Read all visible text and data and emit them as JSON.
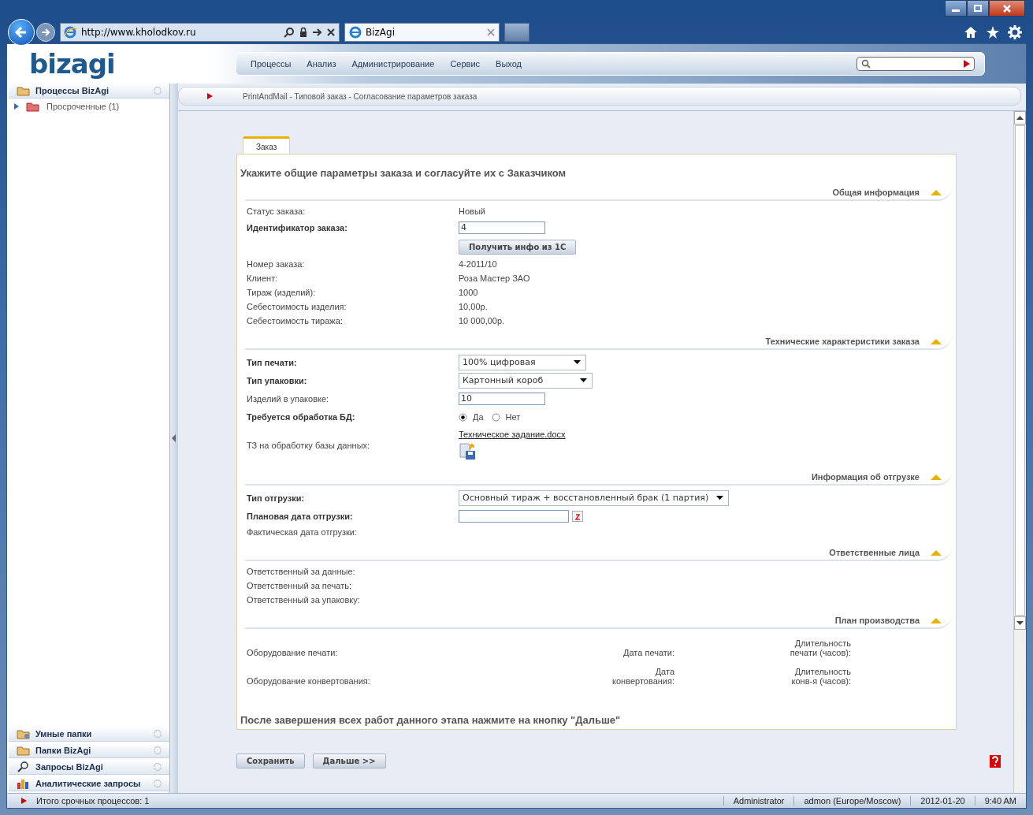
{
  "browser": {
    "url": "http://www.kholodkov.ru",
    "tab_title": "BizAgi"
  },
  "app": {
    "logo": "bizagi",
    "menu": [
      "Процессы",
      "Анализ",
      "Администрирование",
      "Сервис",
      "Выход"
    ],
    "breadcrumb": "PrintAndMail - Типовой заказ - Согласование параметров заказа"
  },
  "sidebar": {
    "top_panel": {
      "title": "Процессы BizAgi",
      "items": [
        {
          "label": "Просроченные (1)",
          "expanded": false
        }
      ]
    },
    "bottom_panels": [
      {
        "title": "Умные папки",
        "kind": "smart"
      },
      {
        "title": "Папки BizAgi",
        "kind": "folders"
      },
      {
        "title": "Запросы BizAgi",
        "kind": "search"
      },
      {
        "title": "Аналитические запросы",
        "kind": "chart"
      }
    ]
  },
  "form": {
    "tabs": [
      {
        "label": "Заказ",
        "selected": true
      }
    ],
    "heading": "Укажите общие параметры заказа и согласуйте их с Заказчиком",
    "sections": [
      {
        "title": "Общая информация",
        "expanded": true,
        "kind": "fields",
        "rows": [
          {
            "label": "Статус заказа:",
            "bold": false,
            "kind": "text",
            "value": "Новый"
          },
          {
            "label": "Идентификатор заказа:",
            "bold": true,
            "kind": "input",
            "value": "4"
          },
          {
            "kind": "button",
            "value": "Получить инфо из 1С"
          },
          {
            "label": "Номер заказа:",
            "bold": false,
            "kind": "text",
            "value": "4-2011/10"
          },
          {
            "label": "Клиент:",
            "bold": false,
            "kind": "text",
            "value": "Роза Мастер ЗАО"
          },
          {
            "label": "Тираж (изделий):",
            "bold": false,
            "kind": "text",
            "value": "1000"
          },
          {
            "label": "Себестоимость изделия:",
            "bold": false,
            "kind": "text",
            "value": "10,00р."
          },
          {
            "label": "Себестоимость тиража:",
            "bold": false,
            "kind": "text",
            "value": "10 000,00р."
          }
        ]
      },
      {
        "title": "Технические характеристики заказа",
        "expanded": true,
        "kind": "fields",
        "rows": [
          {
            "label": "Тип печати:",
            "bold": true,
            "kind": "select",
            "value": "100% цифровая"
          },
          {
            "label": "Тип упаковки:",
            "bold": true,
            "kind": "select",
            "value": "Картонный короб"
          },
          {
            "label": "Изделий в упаковке:",
            "bold": false,
            "kind": "input",
            "value": "10"
          },
          {
            "label": "Требуется обработка БД:",
            "bold": true,
            "kind": "radio",
            "options": [
              {
                "label": "Да",
                "selected": true
              },
              {
                "label": "Нет",
                "selected": false
              }
            ]
          },
          {
            "label": "ТЗ на обработку базы данных:",
            "bold": false,
            "kind": "file",
            "value": "Техническое задание.docx"
          }
        ]
      },
      {
        "title": "Информация об отгрузке",
        "expanded": true,
        "kind": "fields",
        "rows": [
          {
            "label": "Тип отгрузки:",
            "bold": true,
            "kind": "select",
            "value": "Основный тираж + восстановленный брак (1 партия)"
          },
          {
            "label": "Плановая дата отгрузки:",
            "bold": true,
            "kind": "date"
          },
          {
            "label": "Фактическая дата отгрузки:",
            "bold": false,
            "kind": "empty"
          }
        ]
      },
      {
        "title": "Ответственные лица",
        "expanded": true,
        "kind": "fields",
        "rows": [
          {
            "label": "Ответственный за данные:",
            "bold": false,
            "kind": "empty"
          },
          {
            "label": "Ответственный за печать:",
            "bold": false,
            "kind": "empty"
          },
          {
            "label": "Ответственный за упаковку:",
            "bold": false,
            "kind": "empty"
          }
        ]
      },
      {
        "title": "План производства",
        "expanded": true,
        "kind": "plan",
        "rows": [
          {
            "cells": [
              "Оборудование печати:",
              "Дата печати:",
              "Длительность печати (часов):"
            ]
          },
          {
            "cells": [
              "Оборудование конвертования:",
              "Дата конвертования:",
              "Длительность конв-я (часов):"
            ]
          }
        ]
      }
    ],
    "closing_note": "После завершения всех работ данного этапа нажмите на кнопку \"Дальше\"",
    "buttons": [
      "Сохранить",
      "Дальше >>"
    ]
  },
  "status_bar": {
    "left": "Итого срочных процессов: 1",
    "right": [
      "Administrator",
      "admon (Europe/Moscow)",
      "2012-01-20",
      "9:40 AM"
    ]
  }
}
